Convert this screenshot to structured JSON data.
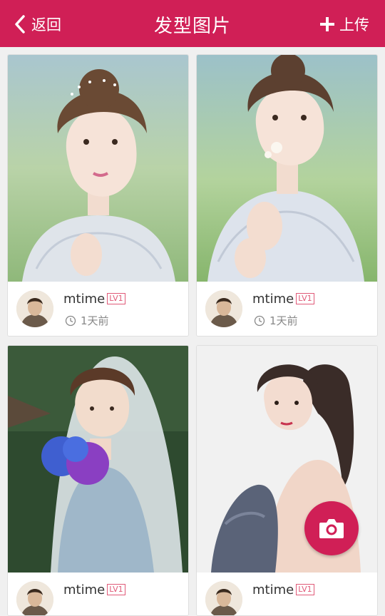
{
  "header": {
    "back_label": "返回",
    "title": "发型图片",
    "upload_label": "上传"
  },
  "posts": [
    {
      "username": "mtime",
      "level": "LV1",
      "time": "1天前"
    },
    {
      "username": "mtime",
      "level": "LV1",
      "time": "1天前"
    },
    {
      "username": "mtime",
      "level": "LV1",
      "time": ""
    },
    {
      "username": "mtime",
      "level": "LV1",
      "time": ""
    }
  ],
  "colors": {
    "brand": "#d01f56",
    "level_badge": "#e05a78"
  },
  "icons": {
    "back": "chevron-left-icon",
    "upload": "plus-icon",
    "time": "clock-icon",
    "camera": "camera-icon"
  }
}
